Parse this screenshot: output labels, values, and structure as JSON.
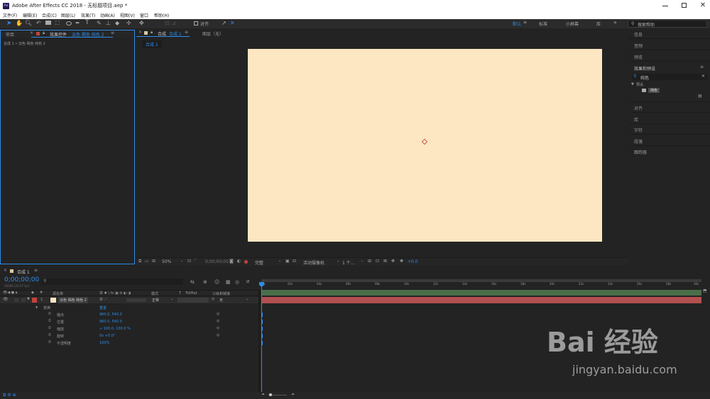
{
  "app": {
    "title": "Adobe After Effects CC 2018 - 无标题项目.aep *",
    "icon_text": "Ae"
  },
  "menu": [
    "文件(F)",
    "编辑(E)",
    "合成(C)",
    "图层(L)",
    "效果(T)",
    "动画(A)",
    "视图(V)",
    "窗口",
    "帮助(H)"
  ],
  "toolbar": {
    "align_label": "对齐",
    "workspaces": [
      "默认",
      "标准",
      "小屏幕",
      "库"
    ],
    "search_placeholder": "搜索帮助"
  },
  "left_panel": {
    "tab_project": "项目",
    "tab_effects": "效果控件",
    "effects_layer": "淡色 褐色 纯色 2",
    "breadcrumb": "合成 1 • 淡色 褐色 纯色 2"
  },
  "comp_panel": {
    "tab_label": "合成",
    "tab_name": "合成 1",
    "layer_tab": "图层（无）",
    "subtab": "合成 1",
    "canvas_color": "#fde6c2",
    "zoom": "50%",
    "timecode": "0;00;00;00",
    "resolution": "完整",
    "camera": "活动摄像机",
    "views": "1 个...",
    "exposure": "+0.0"
  },
  "right_panel": {
    "items_top": [
      "信息",
      "音频",
      "预览"
    ],
    "effects_presets": "效果和预设",
    "search_value": "纯色",
    "category": "预设",
    "result": "纯色",
    "items_bottom": [
      "对齐",
      "库",
      "字符",
      "段落",
      "跟踪器"
    ]
  },
  "timeline": {
    "tab": "合成 1",
    "timecode": "0;00;00;00",
    "fps": "00000 (29.97 fps)",
    "col_source": "源名称",
    "col_switches": "单 ✱ \\ fx ▣ ⊘ ◐ ◑",
    "col_mode": "模式",
    "col_t": "T",
    "col_trkmat": "TrkMat",
    "col_parent": "父级和链接",
    "layer": {
      "num": "1",
      "name": "淡色 褐色 纯色 2",
      "mode": "正常",
      "parent": "无",
      "color": "#c4423b"
    },
    "transform_label": "变换",
    "reset_label": "重置",
    "properties": [
      {
        "name": "锚点",
        "value": "960.0, 540.0"
      },
      {
        "name": "位置",
        "value": "960.0, 540.0"
      },
      {
        "name": "缩放",
        "value": "∞ 100.0, 100.0 %"
      },
      {
        "name": "旋转",
        "value": "0x +0.0°"
      },
      {
        "name": "不透明度",
        "value": "100%"
      }
    ],
    "ruler": [
      "0s",
      "02s",
      "04s",
      "06s",
      "08s",
      "10s",
      "12s",
      "14s",
      "16s",
      "18s",
      "20s",
      "22s",
      "24s",
      "26s",
      "28s",
      "30s"
    ]
  },
  "watermark": {
    "brand": "Bai 经验",
    "url": "jingyan.baidu.com"
  }
}
